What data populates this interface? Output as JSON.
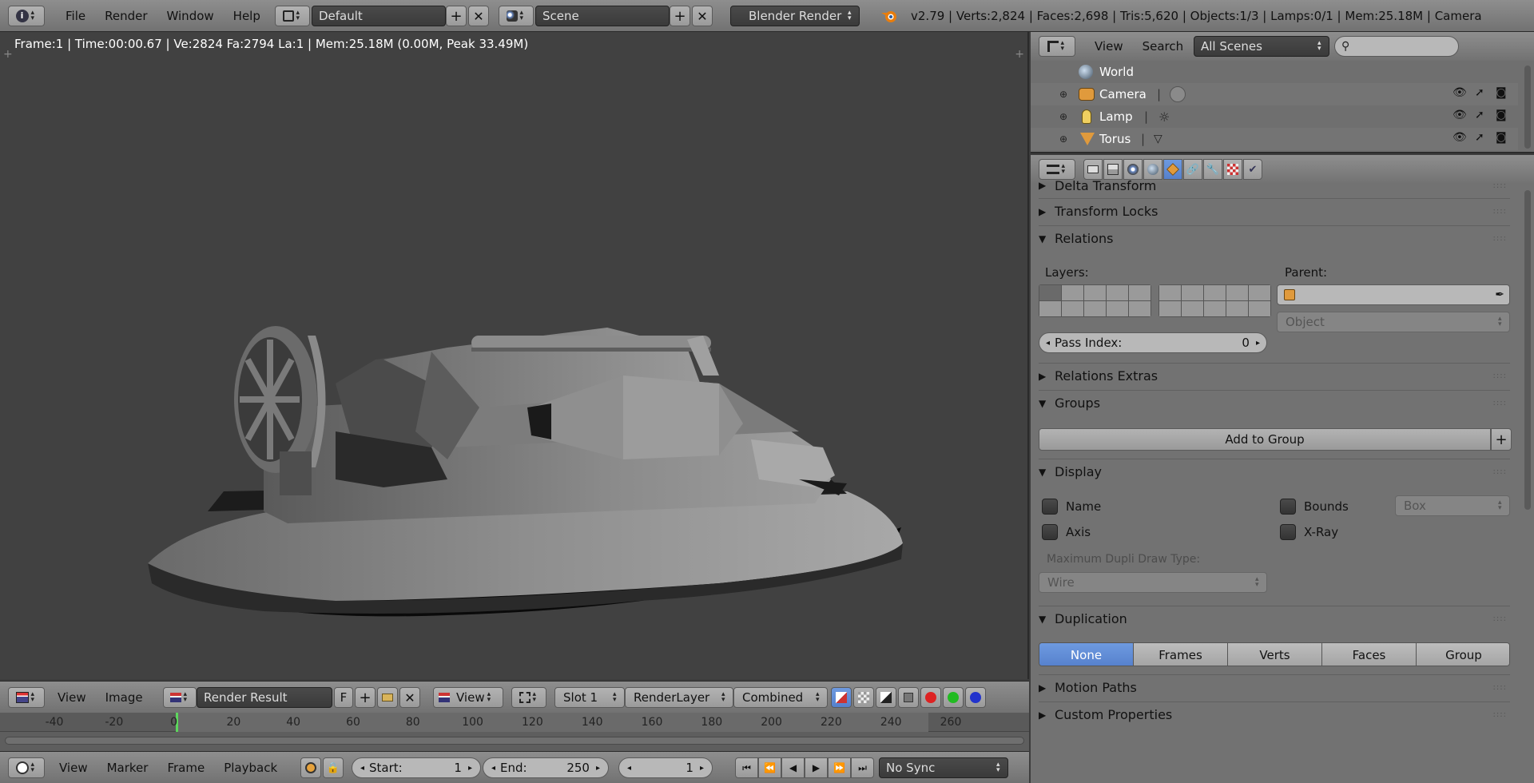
{
  "topbar": {
    "menus": [
      "File",
      "Render",
      "Window",
      "Help"
    ],
    "layout": "Default",
    "scene": "Scene",
    "engine": "Blender Render",
    "stats": "v2.79 | Verts:2,824 | Faces:2,698 | Tris:5,620 | Objects:1/3 | Lamps:0/1 | Mem:25.18M | Camera"
  },
  "viewport": {
    "info": "Frame:1 | Time:00:00.67 | Ve:2824 Fa:2794 La:1 | Mem:25.18M (0.00M, Peak 33.49M)"
  },
  "image_editor": {
    "menus": [
      "View",
      "Image"
    ],
    "image_name": "Render Result",
    "fake_user": "F",
    "view": "View",
    "slot": "Slot 1",
    "render_layer": "RenderLayer",
    "pass": "Combined"
  },
  "ruler": {
    "ticks": [
      "-40",
      "-20",
      "0",
      "20",
      "40",
      "60",
      "80",
      "100",
      "120",
      "140",
      "160",
      "180",
      "200",
      "220",
      "240",
      "260"
    ]
  },
  "timeline": {
    "menus": [
      "View",
      "Marker",
      "Frame",
      "Playback"
    ],
    "start_label": "Start:",
    "start": "1",
    "end_label": "End:",
    "end": "250",
    "current": "1",
    "sync": "No Sync"
  },
  "outliner": {
    "menus": [
      "View",
      "Search"
    ],
    "scenes": "All Scenes",
    "items": [
      {
        "label": "World"
      },
      {
        "label": "Camera"
      },
      {
        "label": "Lamp"
      },
      {
        "label": "Torus"
      }
    ]
  },
  "properties": {
    "panels": {
      "delta_transform": "Delta Transform",
      "transform_locks": "Transform Locks",
      "relations": "Relations",
      "relations_extras": "Relations Extras",
      "groups": "Groups",
      "display": "Display",
      "duplication": "Duplication",
      "motion_paths": "Motion Paths",
      "custom_properties": "Custom Properties"
    },
    "relations": {
      "layers_label": "Layers:",
      "parent_label": "Parent:",
      "parent_type": "Object",
      "pass_index_label": "Pass Index:",
      "pass_index": "0"
    },
    "groups": {
      "add_to_group": "Add to Group"
    },
    "display": {
      "name": "Name",
      "bounds": "Bounds",
      "bounds_type": "Box",
      "axis": "Axis",
      "xray": "X-Ray",
      "dupli_label": "Maximum Dupli Draw Type:",
      "dupli_value": "Wire"
    },
    "duplication": {
      "options": [
        "None",
        "Frames",
        "Verts",
        "Faces",
        "Group"
      ],
      "selected": "None"
    }
  }
}
